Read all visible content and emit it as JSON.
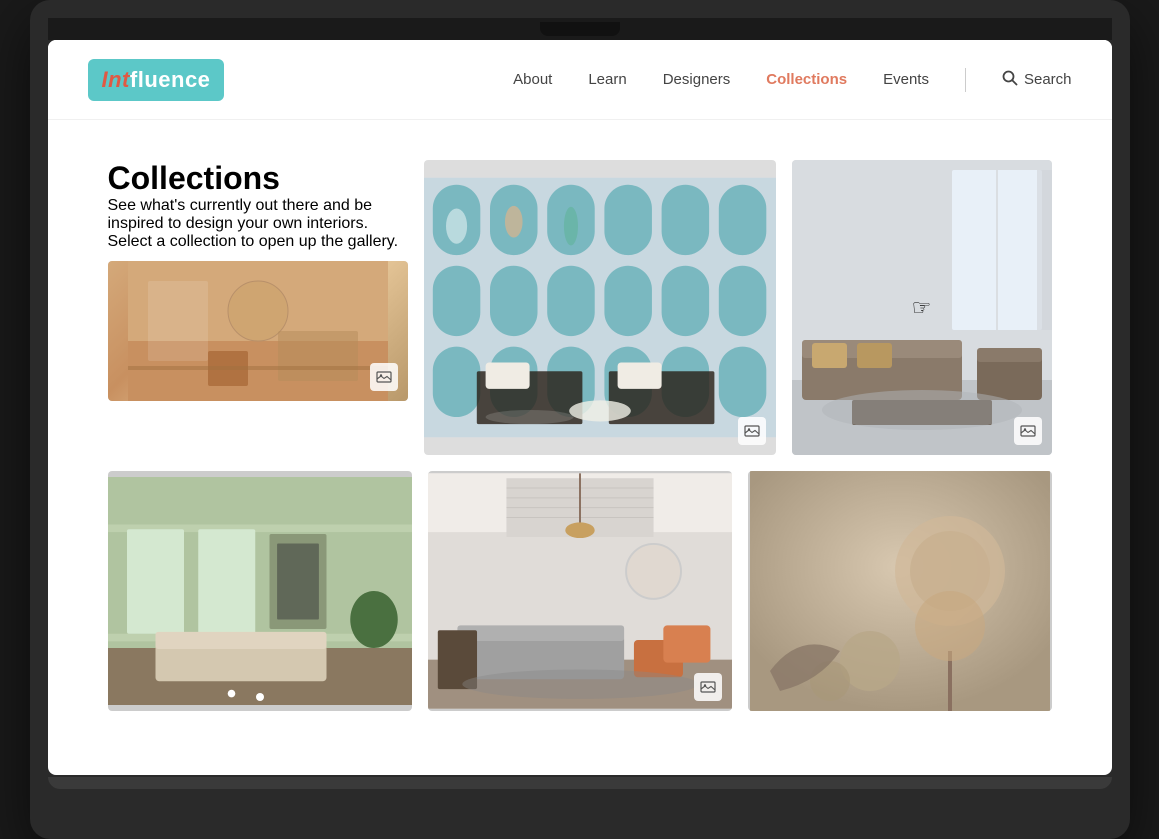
{
  "laptop": {
    "screen_bg": "#fff"
  },
  "nav": {
    "logo_int": "Int",
    "logo_rest": "fluence",
    "links": [
      {
        "label": "About",
        "active": false,
        "id": "about"
      },
      {
        "label": "Learn",
        "active": false,
        "id": "learn"
      },
      {
        "label": "Designers",
        "active": false,
        "id": "designers"
      },
      {
        "label": "Collections",
        "active": true,
        "id": "collections"
      },
      {
        "label": "Events",
        "active": false,
        "id": "events"
      }
    ],
    "search_label": "Search"
  },
  "page": {
    "title": "Collections",
    "subtitle": "See what's currently out there and be inspired to design your own interiors. Select a collection to open up the gallery."
  },
  "colors": {
    "accent": "#e07a5f",
    "logo_bg": "#5cc8c8",
    "logo_int": "#e05a44"
  }
}
